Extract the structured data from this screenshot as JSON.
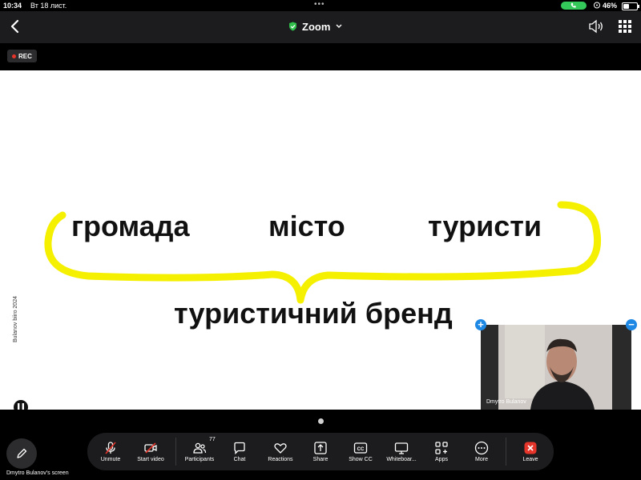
{
  "status_bar": {
    "time": "10:34",
    "date": "Вт 18 лист.",
    "battery": "46%",
    "battery_level": 0.46
  },
  "header": {
    "title": "Zoom",
    "icons": [
      "back-chevron-icon",
      "shield-check-icon",
      "chevron-down-icon",
      "speaker-icon",
      "grid-icon"
    ]
  },
  "recording": {
    "label": "REC"
  },
  "slide": {
    "words": [
      "громада",
      "місто",
      "туристи"
    ],
    "conclusion": "туристичний бренд",
    "footer": "Bulanov biiro 2024",
    "annotation_color": "#f5f000"
  },
  "video": {
    "participant_name": "Dmytro Bulanov",
    "controls": [
      "plus-icon",
      "minus-icon"
    ]
  },
  "bottom": {
    "screen_label": "Dmytro Bulanov's screen",
    "participant_count": "77",
    "toolbar": [
      {
        "label": "Unmute",
        "icon": "mic-off-icon"
      },
      {
        "label": "Start video",
        "icon": "video-off-icon"
      },
      {
        "label": "Participants",
        "icon": "participants-icon"
      },
      {
        "label": "Chat",
        "icon": "chat-icon"
      },
      {
        "label": "Reactions",
        "icon": "heart-icon"
      },
      {
        "label": "Share",
        "icon": "share-icon"
      },
      {
        "label": "Show CC",
        "icon": "cc-icon"
      },
      {
        "label": "Whiteboar...",
        "icon": "whiteboard-icon"
      },
      {
        "label": "Apps",
        "icon": "apps-icon"
      },
      {
        "label": "More",
        "icon": "more-icon"
      },
      {
        "label": "Leave",
        "icon": "leave-icon"
      }
    ]
  },
  "colors": {
    "accent_green": "#34c759",
    "rec_red": "#e5352b",
    "danger_red": "#e5352b",
    "thumb_blue": "#1e88e5",
    "annotation_yellow": "#f5f000"
  }
}
